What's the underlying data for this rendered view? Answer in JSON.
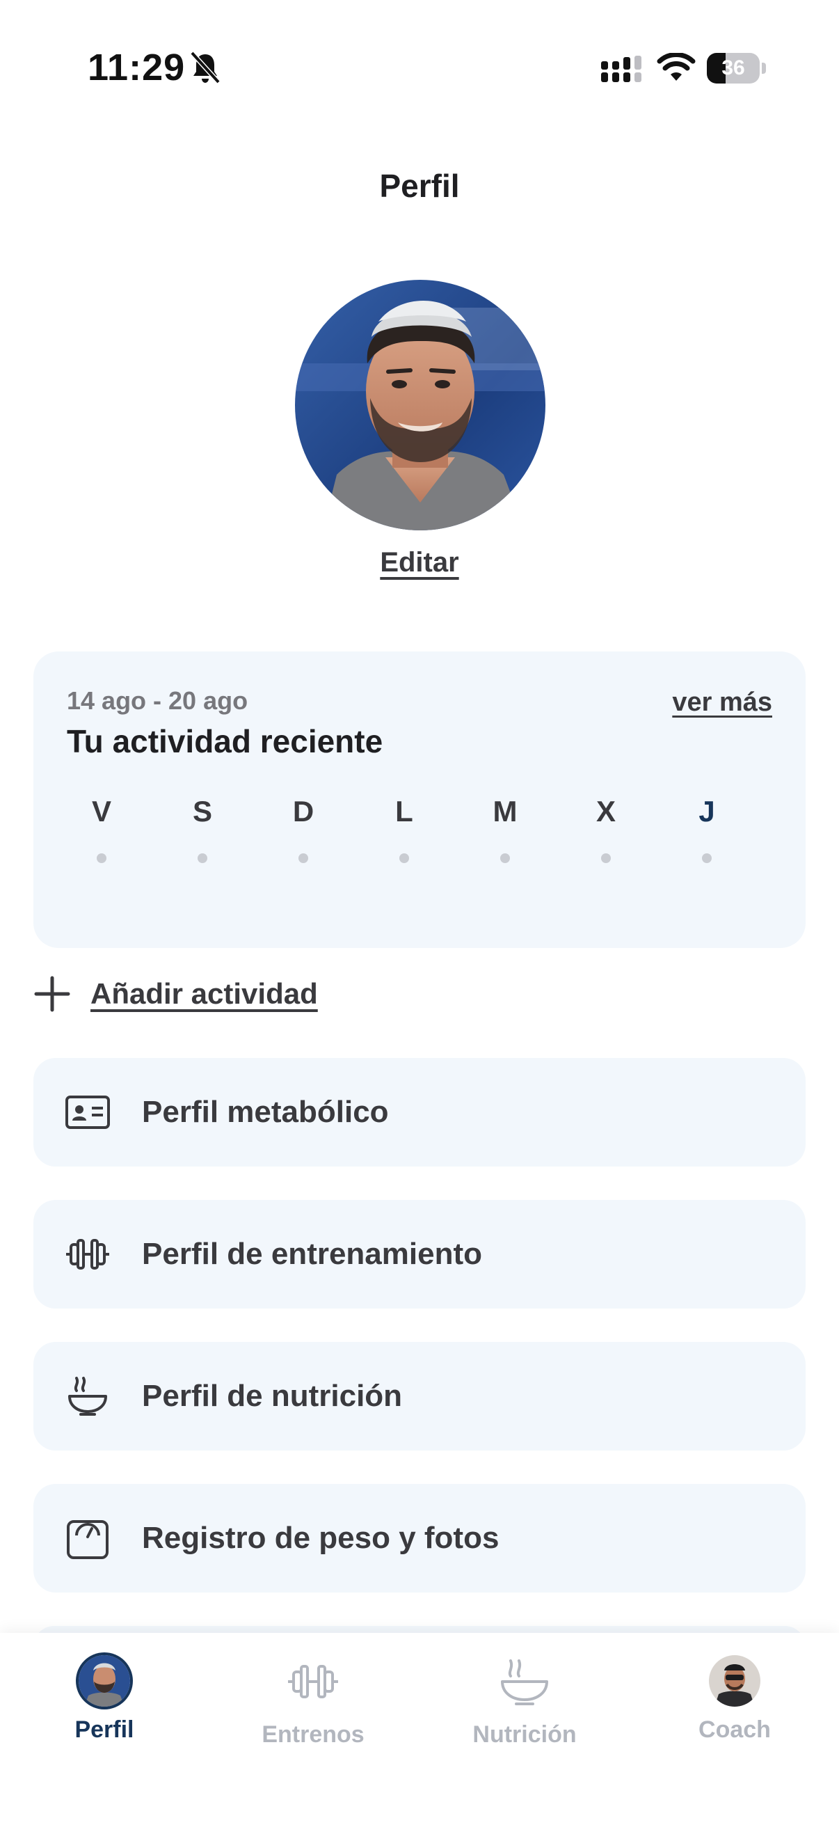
{
  "status_bar": {
    "time": "11:29",
    "battery_level": "36",
    "battery_fraction": 0.36,
    "icons": [
      "bell-slash-icon",
      "signal-icon",
      "wifi-icon",
      "battery-icon"
    ]
  },
  "header": {
    "title": "Perfil"
  },
  "profile": {
    "edit_label": "Editar"
  },
  "activity": {
    "date_range": "14 ago - 20 ago",
    "see_more": "ver más",
    "title": "Tu actividad reciente",
    "days": [
      {
        "letter": "V",
        "current": false
      },
      {
        "letter": "S",
        "current": false
      },
      {
        "letter": "D",
        "current": false
      },
      {
        "letter": "L",
        "current": false
      },
      {
        "letter": "M",
        "current": false
      },
      {
        "letter": "X",
        "current": false
      },
      {
        "letter": "J",
        "current": true
      }
    ]
  },
  "add_activity": {
    "label": "Añadir actividad",
    "icon": "plus-icon"
  },
  "menu": [
    {
      "label": "Perfil metabólico",
      "icon": "id-card-icon"
    },
    {
      "label": "Perfil de entrenamiento",
      "icon": "dumbbell-icon"
    },
    {
      "label": "Perfil de nutrición",
      "icon": "bowl-icon"
    },
    {
      "label": "Registro de peso y fotos",
      "icon": "scale-icon"
    }
  ],
  "tabs": [
    {
      "label": "Perfil",
      "icon": "avatar",
      "active": true
    },
    {
      "label": "Entrenos",
      "icon": "dumbbell-icon",
      "active": false
    },
    {
      "label": "Nutrición",
      "icon": "bowl-icon",
      "active": false
    },
    {
      "label": "Coach",
      "icon": "coach-avatar",
      "active": false
    }
  ],
  "colors": {
    "accent": "#17355a",
    "card_bg": "#f2f7fc",
    "muted": "#b2b6be",
    "text": "#3a3a3e"
  }
}
